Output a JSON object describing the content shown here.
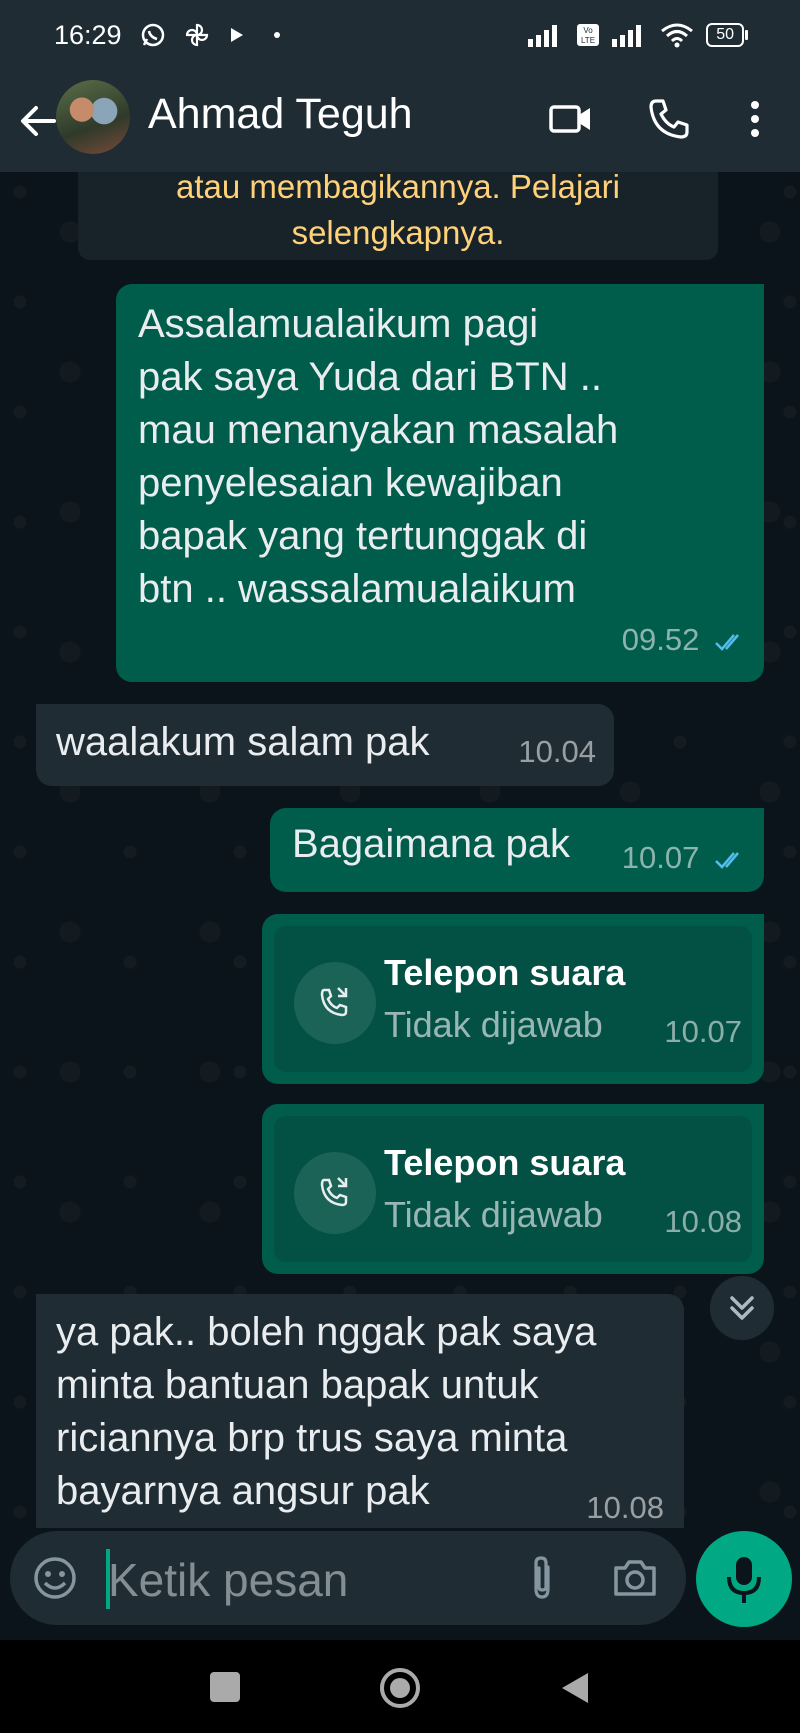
{
  "status_bar": {
    "time": "16:29",
    "battery": "50"
  },
  "header": {
    "contact_name": "Ahmad Teguh"
  },
  "system_note": {
    "line1": "atau membagikannya. Pelajari",
    "line2": "selengkapnya."
  },
  "messages": [
    {
      "direction": "outgoing",
      "lines": [
        "Assalamualaikum pagi",
        "pak saya Yuda dari BTN ..",
        "mau menanyakan masalah",
        "penyelesaian kewajiban",
        "bapak yang tertunggak di",
        "btn .. wassalamualaikum"
      ],
      "time": "09.52",
      "status": "read"
    },
    {
      "direction": "incoming",
      "text": "waalakum salam pak",
      "time": "10.04"
    },
    {
      "direction": "outgoing",
      "text": "Bagaimana pak",
      "time": "10.07",
      "status": "read"
    },
    {
      "direction": "outgoing",
      "type": "call",
      "title": "Telepon suara",
      "subtitle": "Tidak dijawab",
      "time": "10.07"
    },
    {
      "direction": "outgoing",
      "type": "call",
      "title": "Telepon suara",
      "subtitle": "Tidak dijawab",
      "time": "10.08"
    },
    {
      "direction": "incoming",
      "lines": [
        "ya pak.. boleh nggak pak saya",
        "minta bantuan bapak untuk",
        "riciannya brp trus saya minta",
        "bayarnya  angsur pak"
      ],
      "time": "10.08"
    }
  ],
  "composer": {
    "placeholder": "Ketik pesan"
  },
  "colors": {
    "outgoing_bubble": "#005c4b",
    "incoming_bubble": "#202c33",
    "accent": "#00a884",
    "read_ticks": "#53bdeb",
    "note_text": "#ffd279"
  },
  "icons": [
    "whatsapp-icon",
    "pinwheel-icon",
    "play-icon",
    "signal-icon",
    "volte-icon",
    "wifi-icon",
    "battery-icon",
    "back-arrow-icon",
    "video-call-icon",
    "phone-icon",
    "more-options-icon",
    "missed-call-icon",
    "double-check-icon",
    "scroll-down-icon",
    "emoji-icon",
    "attach-icon",
    "camera-icon",
    "mic-icon",
    "nav-recents-icon",
    "nav-home-icon",
    "nav-back-icon"
  ]
}
